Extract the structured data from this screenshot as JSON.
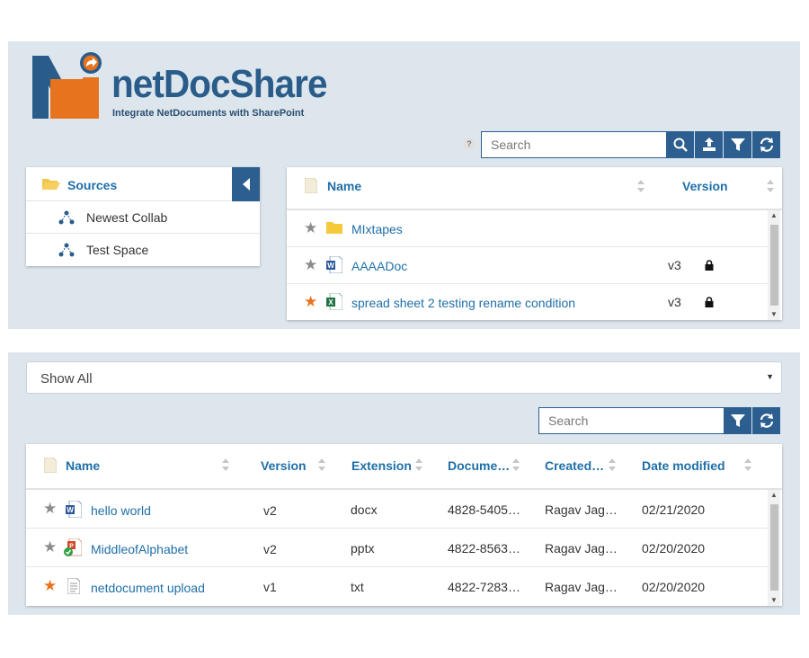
{
  "brand": {
    "name": "netDocShare",
    "tagline": "Integrate NetDocuments with SharePoint",
    "colors": {
      "blue": "#2a5c8a",
      "orange": "#e8731f",
      "accent": "#2c5e8f",
      "link": "#1f6fa8"
    }
  },
  "top_toolbar": {
    "help": "?",
    "search_placeholder": "Search",
    "buttons": [
      "search-icon",
      "upload-icon",
      "filter-icon",
      "refresh-icon"
    ]
  },
  "sources": {
    "title": "Sources",
    "items": [
      {
        "label": "Newest Collab",
        "icon": "network-icon"
      },
      {
        "label": "Test Space",
        "icon": "network-icon"
      }
    ]
  },
  "top_table": {
    "columns": {
      "name": "Name",
      "version": "Version"
    },
    "rows": [
      {
        "starred": false,
        "type": "folder",
        "name": "MIxtapes",
        "version": "",
        "locked": false
      },
      {
        "starred": false,
        "type": "word",
        "name": "AAAADoc",
        "version": "v3",
        "locked": true
      },
      {
        "starred": true,
        "type": "excel",
        "name": "spread sheet 2 testing rename condition",
        "version": "v3",
        "locked": true
      }
    ]
  },
  "filter_select": {
    "value": "Show All"
  },
  "bottom_toolbar": {
    "search_placeholder": "Search",
    "buttons": [
      "filter-icon",
      "refresh-icon"
    ]
  },
  "bottom_table": {
    "columns": {
      "name": "Name",
      "version": "Version",
      "extension": "Extension",
      "document": "Docume…",
      "created": "Created…",
      "modified": "Date modified"
    },
    "rows": [
      {
        "starred": false,
        "type": "word",
        "name": "hello world",
        "version": "v2",
        "extension": "docx",
        "document": "4828-5405…",
        "created": "Ragav Jag…",
        "modified": "02/21/2020"
      },
      {
        "starred": false,
        "type": "powerpoint-checked",
        "name": "MiddleofAlphabet",
        "version": "v2",
        "extension": "pptx",
        "document": "4822-8563…",
        "created": "Ragav Jag…",
        "modified": "02/20/2020"
      },
      {
        "starred": true,
        "type": "text",
        "name": "netdocument upload",
        "version": "v1",
        "extension": "txt",
        "document": "4822-7283…",
        "created": "Ragav Jag…",
        "modified": "02/20/2020"
      }
    ]
  }
}
